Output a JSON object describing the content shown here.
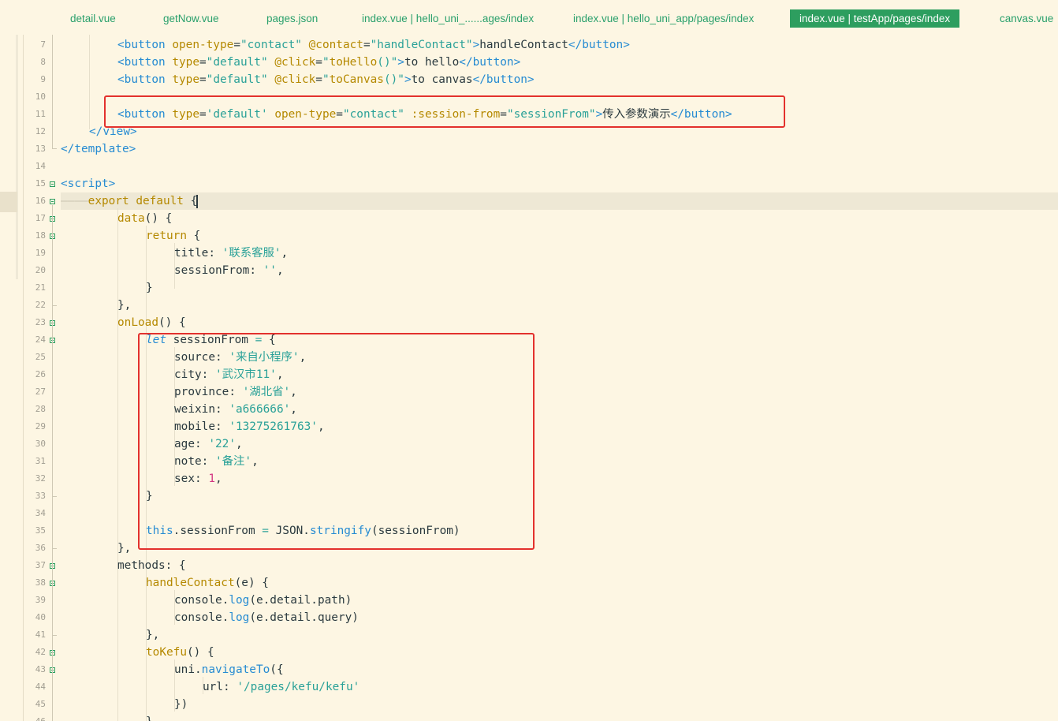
{
  "tabs": [
    {
      "label": "detail.vue",
      "active": false
    },
    {
      "label": "getNow.vue",
      "active": false
    },
    {
      "label": "pages.json",
      "active": false
    },
    {
      "label": "index.vue | hello_uni_......ages/index",
      "active": false
    },
    {
      "label": "index.vue | hello_uni_app/pages/index",
      "active": false
    },
    {
      "label": "index.vue | testApp/pages/index",
      "active": true
    },
    {
      "label": "canvas.vue",
      "active": false
    }
  ],
  "editor": {
    "line_numbers": [
      "7",
      "8",
      "9",
      "10",
      "11",
      "12",
      "13",
      "14",
      "15",
      "16",
      "17",
      "18",
      "19",
      "20",
      "21",
      "22",
      "23",
      "24",
      "25",
      "26",
      "27",
      "28",
      "29",
      "30",
      "31",
      "32",
      "33",
      "34",
      "35",
      "36",
      "37",
      "38",
      "39",
      "40",
      "41",
      "42",
      "43",
      "44",
      "45",
      "46"
    ],
    "current_line": "16",
    "code": {
      "l7": {
        "tag": "button",
        "attr1": "open-type",
        "val1": "\"contact\"",
        "attr2": "@contact",
        "val2": "\"handleContact\"",
        "text": "handleContact",
        "close": "</button>"
      },
      "l8": {
        "tag": "button",
        "attr1": "type",
        "val1": "\"default\"",
        "attr2": "@click",
        "val2a": "\"",
        "fn": "toHello",
        "val2b": "()\"",
        "text": "to hello",
        "close": "</button>"
      },
      "l9": {
        "tag": "button",
        "attr1": "type",
        "val1": "\"default\"",
        "attr2": "@click",
        "val2a": "\"",
        "fn": "toCanvas",
        "val2b": "()\"",
        "text": "to canvas",
        "close": "</button>"
      },
      "l11": {
        "tag": "button",
        "attr1": "type",
        "val1": "'default'",
        "attr2": "open-type",
        "val2": "\"contact\"",
        "attr3": ":session-from",
        "val3": "\"sessionFrom\"",
        "text": "传入参数演示",
        "close": "</button>"
      },
      "l12": "</view>",
      "l13": "</template>",
      "l15": "<script>",
      "l16": {
        "kw1": "export",
        "kw2": "default",
        "brace": "{"
      },
      "l17": {
        "name": "data",
        "rest": "() {"
      },
      "l18": {
        "kw": "return",
        "rest": " {"
      },
      "l19": {
        "key": "title",
        "val": "'联系客服'",
        "end": ","
      },
      "l20": {
        "key": "sessionFrom",
        "val": "''",
        "end": ","
      },
      "l21": "}",
      "l22": "},",
      "l23": {
        "name": "onLoad",
        "rest": "() {"
      },
      "l24": {
        "kw": "let",
        "name": " sessionFrom ",
        "op": "=",
        "rest": " {"
      },
      "l25": {
        "key": "source",
        "val": "'来自小程序'",
        "end": ","
      },
      "l26": {
        "key": "city",
        "val": "'武汉市11'",
        "end": ","
      },
      "l27": {
        "key": "province",
        "val": "'湖北省'",
        "end": ","
      },
      "l28": {
        "key": "weixin",
        "val": "'a666666'",
        "end": ","
      },
      "l29": {
        "key": "mobile",
        "val": "'13275261763'",
        "end": ","
      },
      "l30": {
        "key": "age",
        "val": "'22'",
        "end": ","
      },
      "l31": {
        "key": "note",
        "val": "'备注'",
        "end": ","
      },
      "l32": {
        "key": "sex",
        "num": "1",
        "end": ","
      },
      "l33": "}",
      "l35": {
        "this": "this",
        "prop": ".sessionFrom ",
        "op": "=",
        "obj": " JSON.",
        "fn": "stringify",
        "rest": "(sessionFrom)"
      },
      "l36": "},",
      "l37": {
        "key": "methods",
        "rest": ": {"
      },
      "l38": {
        "name": "handleContact",
        "rest": "(e) {"
      },
      "l39": {
        "obj": "console.",
        "fn": "log",
        "rest": "(e.detail.path)"
      },
      "l40": {
        "obj": "console.",
        "fn": "log",
        "rest": "(e.detail.query)"
      },
      "l41": "},",
      "l42": {
        "name": "toKefu",
        "rest": "() {"
      },
      "l43": {
        "obj": "uni.",
        "fn": "navigateTo",
        "rest": "({"
      },
      "l44": {
        "key": "url",
        "sep": ": ",
        "val": "'/pages/kefu/kefu'"
      },
      "l45": "})",
      "l46": "}"
    }
  },
  "colors": {
    "background": "#FDF6E3",
    "tab_text": "#2AA06C",
    "tab_active_bg": "#2D9E5F",
    "highlight_box": "#E3312D"
  }
}
